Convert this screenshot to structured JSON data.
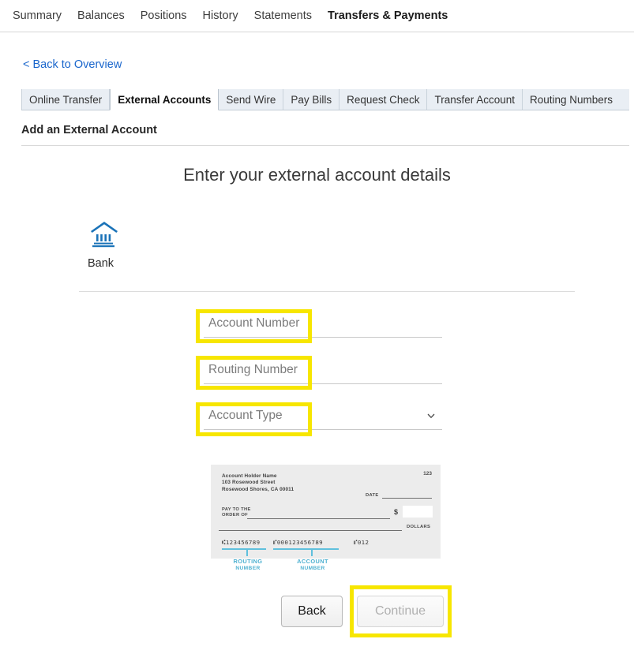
{
  "topnav": {
    "items": [
      {
        "label": "Summary",
        "active": false
      },
      {
        "label": "Balances",
        "active": false
      },
      {
        "label": "Positions",
        "active": false
      },
      {
        "label": "History",
        "active": false
      },
      {
        "label": "Statements",
        "active": false
      },
      {
        "label": "Transfers & Payments",
        "active": true
      }
    ]
  },
  "back_link": "< Back to Overview",
  "tabs": [
    {
      "label": "Online Transfer",
      "active": false
    },
    {
      "label": "External Accounts",
      "active": true
    },
    {
      "label": "Send Wire",
      "active": false
    },
    {
      "label": "Pay Bills",
      "active": false
    },
    {
      "label": "Request Check",
      "active": false
    },
    {
      "label": "Transfer Account",
      "active": false
    },
    {
      "label": "Routing Numbers",
      "active": false
    }
  ],
  "section_title": "Add an External Account",
  "page_heading": "Enter your external account details",
  "account_type_block": {
    "icon": "bank-icon",
    "label": "Bank"
  },
  "form": {
    "account_number": {
      "placeholder": "Account Number",
      "value": ""
    },
    "routing_number": {
      "placeholder": "Routing Number",
      "value": ""
    },
    "account_type": {
      "placeholder": "Account Type",
      "value": "",
      "icon": "chevron-down-icon"
    }
  },
  "check_sample": {
    "holder_name": "Account Holder Name",
    "address_line1": "103 Rosewood Street",
    "address_line2": "Rosewood Shores, CA 00011",
    "check_number": "123",
    "date_label": "DATE",
    "pay_to_line1": "PAY TO THE",
    "pay_to_line2": "ORDER OF",
    "currency_symbol": "$",
    "dollars_label": "DOLLARS",
    "micr_routing": "⑆123456789",
    "micr_account": "⑈000123456789",
    "micr_check": "⑈012",
    "caption_routing_line1": "ROUTING",
    "caption_routing_line2": "NUMBER",
    "caption_account_line1": "ACCOUNT",
    "caption_account_line2": "NUMBER"
  },
  "buttons": {
    "back": "Back",
    "continue": "Continue"
  },
  "colors": {
    "highlight": "#f7e600",
    "link": "#1a66cc",
    "bank_icon": "#1b73b8",
    "micr_accent": "#4db0d0",
    "tab_strip_bg": "#e9eef4"
  }
}
